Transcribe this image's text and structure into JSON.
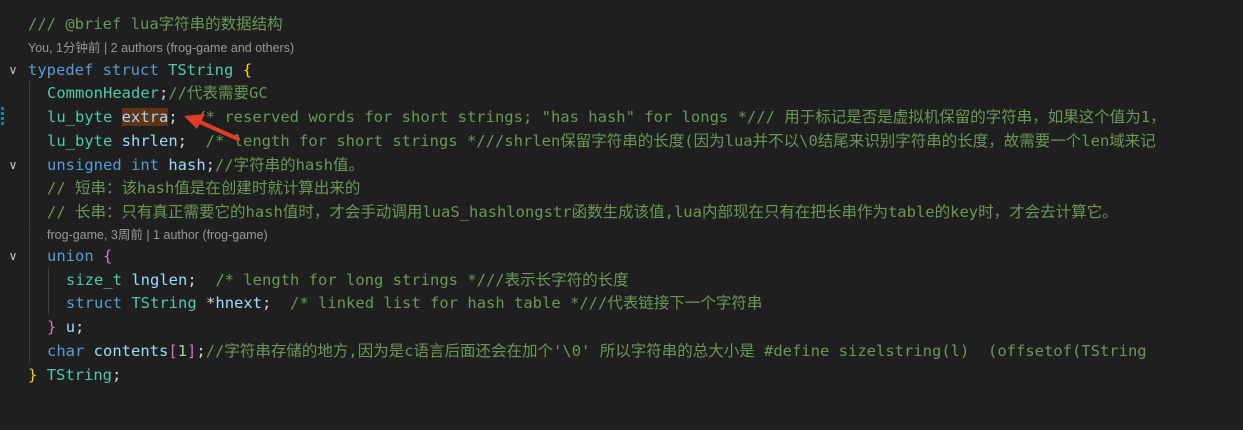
{
  "editor": {
    "lens_top": "You, 1分钟前 | 2 authors (frog-game and others)",
    "lens_mid": "frog-game, 3周前 | 1 author (frog-game)",
    "fold_glyph": "∨",
    "tokens": {
      "l1": [
        "/// @brief lua字符串的数据结构"
      ],
      "l2": [
        "typedef",
        " ",
        "struct",
        " ",
        "TString",
        " ",
        "{"
      ],
      "l3": [
        "CommonHeader",
        ";",
        "//代表需要GC"
      ],
      "l4": [
        "lu_byte",
        " ",
        "extra",
        ";",
        "  /* reserved words for short strings; \"has hash\" for longs */// 用于标记是否是虚拟机保留的字符串，如果这个值为1，"
      ],
      "l5": [
        "lu_byte",
        " ",
        "shrlen",
        ";",
        "  /* length for short strings *///shrlen保留字符串的长度(因为lua并不以\\0结尾来识别字符串的长度，故需要一个len域来记"
      ],
      "l6": [
        "unsigned",
        " ",
        "int",
        " ",
        "hash",
        ";",
        "//字符串的hash值。"
      ],
      "l7": [
        "// 短串：该hash值是在创建时就计算出来的"
      ],
      "l8": [
        "// 长串：只有真正需要它的hash值时，才会手动调用luaS_hashlongstr函数生成该值,lua内部现在只有在把长串作为table的key时，才会去计算它。"
      ],
      "l9": [
        "union",
        " ",
        "{"
      ],
      "l10": [
        "size_t",
        " ",
        "lnglen",
        ";",
        "  /* length for long strings *///表示长字符的长度"
      ],
      "l11": [
        "struct",
        " ",
        "TString",
        " ",
        "*",
        "hnext",
        ";",
        "  /* linked list for hash table *///代表链接下一个字符串"
      ],
      "l12": [
        "}",
        " ",
        "u",
        ";"
      ],
      "l13": [
        "char",
        " ",
        "contents",
        "[",
        "1",
        "]",
        ";",
        "//字符串存储的地方,因为是c语言后面还会在加个'\\0' 所以字符串的总大小是 #define sizelstring(l)  (offsetof(TString"
      ],
      "l14": [
        "}",
        " ",
        "TString",
        ";"
      ]
    }
  },
  "colors": {
    "background": "#1f1f1f",
    "comment": "#6a9955",
    "keyword": "#569cd6",
    "type": "#4ec9b0",
    "variable": "#9cdcfe",
    "number": "#b5cea8",
    "bracket_gold": "#ffd700",
    "bracket_purple": "#da70d6",
    "annotation_arrow": "#e03c28"
  },
  "icons": {
    "fold": "chevron-down-icon",
    "annotation": "red-arrow-icon"
  }
}
